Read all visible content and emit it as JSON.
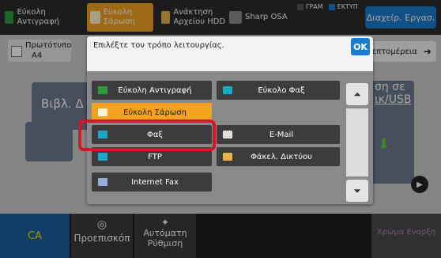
{
  "topbar": {
    "tabs": [
      {
        "label": "Εύκολη Αντιγραφή",
        "icon": "copy-icon",
        "color": "#2e9a3b"
      },
      {
        "label": "Εύκολη Σάρωση",
        "icon": "scan-icon",
        "color": "#f2a21f",
        "active": true
      },
      {
        "label": "Ανάκτηση Αρχείου HDD",
        "icon": "folder-icon",
        "color": "#e6b24a"
      },
      {
        "label": "Sharp OSA",
        "icon": "osa-icon",
        "color": "#8a8a8a"
      }
    ],
    "status_line": "ΓΡΑΜ",
    "status_print": "ΕΚΤΥΠ",
    "admin_label": "Διαχείρ. Εργασ."
  },
  "base": {
    "original_label": "Πρωτότυπο",
    "original_size": "A4",
    "details_label": "Λεπτομέρεια",
    "left_tile_text": "Βιβλ. Δ",
    "right_tile_text_1": "ση σε",
    "right_tile_text_2": "ικ/USB",
    "bottom": {
      "ca_label": "CA",
      "preview_label": "Προεπισκόπ",
      "auto_label": "Αυτόματη Ρύθμιση",
      "start_label": "Χρώμα Εναρξη"
    }
  },
  "dialog": {
    "title": "Επιλέξτε τον τρόπο λειτουργίας.",
    "ok_label": "OK",
    "options": [
      {
        "label": "Εύκολη Αντιγραφή",
        "icon": "copy-icon",
        "icon_color": "#2e9a3b"
      },
      {
        "label": "Εύκολο Φαξ",
        "icon": "fax-icon",
        "icon_color": "#1aa7c8"
      },
      {
        "label": "Εύκολη Σάρωση",
        "icon": "scan-icon",
        "icon_color": "#f2a21f",
        "active": true
      },
      {
        "label": "Φαξ",
        "icon": "fax-icon",
        "icon_color": "#1aa7c8",
        "selected": true
      },
      {
        "label": "E-Mail",
        "icon": "email-icon",
        "icon_color": "#e0e0e0"
      },
      {
        "label": "FTP",
        "icon": "ftp-icon",
        "icon_color": "#1aa7c8"
      },
      {
        "label": "Φάκελ. Δικτύου",
        "icon": "folder-icon",
        "icon_color": "#e6b24a"
      },
      {
        "label": "Internet Fax",
        "icon": "internet-fax-icon",
        "icon_color": "#9ad"
      }
    ]
  },
  "colors": {
    "accent_blue": "#1a7ccf",
    "accent_orange": "#f2a21f",
    "highlight_red": "#d0182a"
  }
}
